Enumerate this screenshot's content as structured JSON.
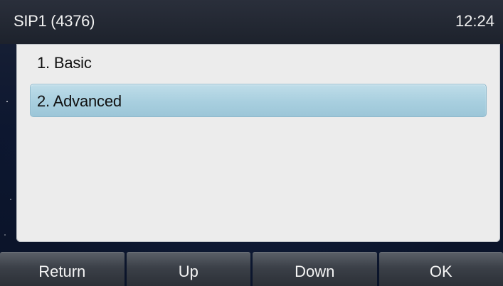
{
  "status_bar": {
    "account": "SIP1 (4376)",
    "time": "12:24"
  },
  "menu": {
    "items": [
      {
        "label": "1. Basic",
        "selected": false
      },
      {
        "label": "2. Advanced",
        "selected": true
      }
    ]
  },
  "softkeys": {
    "return": "Return",
    "up": "Up",
    "down": "Down",
    "ok": "OK"
  },
  "colors": {
    "status_bar": "#22272f",
    "panel": "#ececec",
    "selection": "#a8cfdf",
    "softkey": "#3b4048"
  }
}
